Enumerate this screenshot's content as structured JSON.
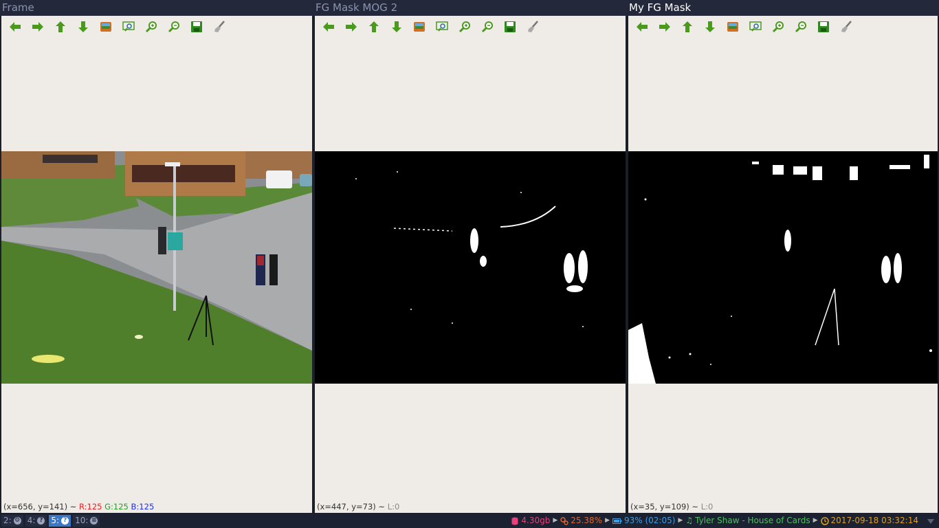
{
  "windows": [
    {
      "title": "Frame",
      "status": {
        "coords": "(x=656, y=141) ~ ",
        "r": "R:125",
        "g": "G:125",
        "b": "B:125"
      }
    },
    {
      "title": "FG Mask MOG 2",
      "status": {
        "coords": "(x=447, y=73) ~ ",
        "l": "L:0"
      }
    },
    {
      "title": "My FG Mask",
      "status": {
        "coords": "(x=35, y=109) ~ ",
        "l": "L:0"
      }
    }
  ],
  "toolbar_icons": [
    "arrow-left-icon",
    "arrow-right-icon",
    "arrow-up-icon",
    "arrow-down-icon",
    "image-icon",
    "zoom-fit-icon",
    "zoom-in-icon",
    "zoom-out-icon",
    "save-icon",
    "brush-icon"
  ],
  "taskbar": {
    "workspaces": [
      {
        "label": "2:",
        "icon": "browser-icon",
        "glyph": "⚙",
        "focused": false
      },
      {
        "label": "4:",
        "icon": "help-icon",
        "glyph": "?",
        "focused": false
      },
      {
        "label": "5:",
        "icon": "help-icon",
        "glyph": "?",
        "focused": true
      },
      {
        "label": "10:",
        "icon": "menu-icon",
        "glyph": "≡",
        "focused": false
      }
    ],
    "memory": "4.30gb",
    "cpu": "25.38%",
    "battery": "93% (02:05)",
    "music": "Tyler Shaw - House of Cards",
    "clock": "2017-09-18 03:32:14"
  },
  "colors": {
    "active_title": "#ffffff",
    "inactive_title": "#8a94b0",
    "workspace_focused": "#3a78c6"
  }
}
